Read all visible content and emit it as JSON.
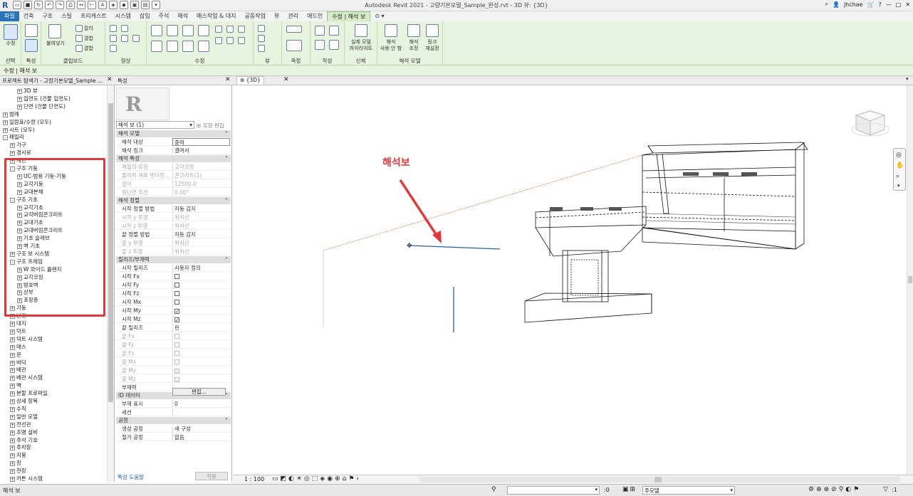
{
  "titlebar": {
    "title": "Autodesk Revit 2021 - 고량기본모델_Sample_완성.rvt - 3D 뷰: {3D}",
    "user": "jhchae"
  },
  "tabs": [
    "파일",
    "건축",
    "구조",
    "스틸",
    "프리캐스트",
    "시스템",
    "삽입",
    "주석",
    "해석",
    "매스작업 & 대지",
    "공동작업",
    "뷰",
    "관리",
    "애드인",
    "수정 | 해석 보"
  ],
  "ribbon": {
    "groups": [
      "선택",
      "특성",
      "클립보드",
      "형상",
      "수정",
      "뷰",
      "측정",
      "작성",
      "신체",
      "해석 모델"
    ],
    "modify_label": "수정",
    "paste_label": "붙여넣기",
    "highlight_label": "실제 모델\n하이라이트",
    "beam_tool_label": "해석\n사용 안 함",
    "adjust_label": "해석\n조정",
    "link_label": "링크\n재설정",
    "clipboard_labels": [
      "잘라",
      "결합",
      "결합"
    ]
  },
  "optionsbar": {
    "text": "수정 | 해석 보"
  },
  "panels": {
    "browser_title": "프로젝트 탐색기 - 고량기본모델_Sample ...",
    "properties_title": "특성",
    "view_tab": "{3D}"
  },
  "browser": {
    "items": [
      {
        "label": "3D 뷰",
        "level": 2,
        "exp": "+"
      },
      {
        "label": "입면도 (건물 입면도)",
        "level": 2,
        "exp": "+"
      },
      {
        "label": "단면 (건물 단면도)",
        "level": 2,
        "exp": "+"
      },
      {
        "label": "범례",
        "level": 0,
        "exp": "+"
      },
      {
        "label": "일람표/수량 (모두)",
        "level": 0,
        "exp": "+"
      },
      {
        "label": "시트 (모두)",
        "level": 0,
        "exp": "+"
      },
      {
        "label": "패밀리",
        "level": 0,
        "exp": "-"
      },
      {
        "label": "가구",
        "level": 1,
        "exp": "+"
      },
      {
        "label": "경사로",
        "level": 1,
        "exp": "+"
      },
      {
        "label": "계단",
        "level": 1,
        "exp": "+"
      },
      {
        "label": "구조 기둥",
        "level": 1,
        "exp": "-"
      },
      {
        "label": "UC-범용 기둥-기둥",
        "level": 2,
        "exp": "+"
      },
      {
        "label": "교각기둥",
        "level": 2,
        "exp": "+"
      },
      {
        "label": "교대본체",
        "level": 2,
        "exp": "+"
      },
      {
        "label": "구조 기초",
        "level": 1,
        "exp": "-"
      },
      {
        "label": "교각기초",
        "level": 2,
        "exp": "+"
      },
      {
        "label": "교각버림콘크리트",
        "level": 2,
        "exp": "+"
      },
      {
        "label": "교대기초",
        "level": 2,
        "exp": "+"
      },
      {
        "label": "교대버림콘크리트",
        "level": 2,
        "exp": "+"
      },
      {
        "label": "기초 슬래브",
        "level": 2,
        "exp": "+"
      },
      {
        "label": "벽 기초",
        "level": 2,
        "exp": "+"
      },
      {
        "label": "구조 보 시스템",
        "level": 1,
        "exp": "+"
      },
      {
        "label": "구조 프레임",
        "level": 1,
        "exp": "-"
      },
      {
        "label": "W 와이드 플랜지",
        "level": 2,
        "exp": "+"
      },
      {
        "label": "교각코핑",
        "level": 2,
        "exp": "+"
      },
      {
        "label": "방호벽",
        "level": 2,
        "exp": "+"
      },
      {
        "label": "상부",
        "level": 2,
        "exp": "+"
      },
      {
        "label": "포장층",
        "level": 2,
        "exp": "+"
      },
      {
        "label": "기둥",
        "level": 1,
        "exp": "+"
      },
      {
        "label": "난간",
        "level": 1,
        "exp": "+"
      },
      {
        "label": "대지",
        "level": 1,
        "exp": "+"
      },
      {
        "label": "덕트",
        "level": 1,
        "exp": "+"
      },
      {
        "label": "덕트 시스템",
        "level": 1,
        "exp": "+"
      },
      {
        "label": "매스",
        "level": 1,
        "exp": "+"
      },
      {
        "label": "문",
        "level": 1,
        "exp": "+"
      },
      {
        "label": "바닥",
        "level": 1,
        "exp": "+"
      },
      {
        "label": "배관",
        "level": 1,
        "exp": "+"
      },
      {
        "label": "배관 시스템",
        "level": 1,
        "exp": "+"
      },
      {
        "label": "벽",
        "level": 1,
        "exp": "+"
      },
      {
        "label": "분할 프로파일",
        "level": 1,
        "exp": "+"
      },
      {
        "label": "상세 항목",
        "level": 1,
        "exp": "+"
      },
      {
        "label": "수직",
        "level": 1,
        "exp": "+"
      },
      {
        "label": "일반 모델",
        "level": 1,
        "exp": "+"
      },
      {
        "label": "전선관",
        "level": 1,
        "exp": "+"
      },
      {
        "label": "조명 설비",
        "level": 1,
        "exp": "+"
      },
      {
        "label": "주석 기호",
        "level": 1,
        "exp": "+"
      },
      {
        "label": "주차장",
        "level": 1,
        "exp": "+"
      },
      {
        "label": "지붕",
        "level": 1,
        "exp": "+"
      },
      {
        "label": "창",
        "level": 1,
        "exp": "+"
      },
      {
        "label": "천장",
        "level": 1,
        "exp": "+"
      },
      {
        "label": "커튼 시스템",
        "level": 1,
        "exp": "+"
      }
    ]
  },
  "properties": {
    "type_selector": "해석 보 (1)",
    "edit_type": "유형 편집",
    "sections": [
      {
        "title": "해석 모델",
        "rows": [
          {
            "k": "해석 대상",
            "v": "중력",
            "editable": true
          },
          {
            "k": "해석 링크",
            "v": "결여서"
          }
        ]
      },
      {
        "title": "해석 특성",
        "rows": [
          {
            "k": "재질의 유형",
            "v": "교각코핑",
            "dim": true
          },
          {
            "k": "물리적 재료 렌더링...",
            "v": "콘크리트(1)",
            "dim": true
          },
          {
            "k": "길이",
            "v": "12500.0",
            "dim": true
          },
          {
            "k": "횡단면 회전",
            "v": "0.00°",
            "dim": true
          }
        ]
      },
      {
        "title": "해석 정렬",
        "rows": [
          {
            "k": "시작 정렬 방법",
            "v": "자동 감지"
          },
          {
            "k": "시작 y 투영",
            "v": "위치선",
            "dim": true
          },
          {
            "k": "시작 z 투영",
            "v": "위치선",
            "dim": true
          },
          {
            "k": "끝 정렬 방법",
            "v": "자동 감지"
          },
          {
            "k": "끝 y 투영",
            "v": "위치선",
            "dim": true
          },
          {
            "k": "끝 z 투영",
            "v": "위치선",
            "dim": true
          }
        ]
      },
      {
        "title": "릴리즈/부재력",
        "rows": [
          {
            "k": "시작 릴리즈",
            "v": "사용자 정의"
          },
          {
            "k": "시작 Fx",
            "cb": false
          },
          {
            "k": "시작 Fy",
            "cb": false
          },
          {
            "k": "시작 Fz",
            "cb": false
          },
          {
            "k": "시작 Mx",
            "cb": false
          },
          {
            "k": "시작 My",
            "cb": true
          },
          {
            "k": "시작 Mz",
            "cb": true
          },
          {
            "k": "끝 릴리즈",
            "v": "핀"
          },
          {
            "k": "끝 Fx",
            "cb": false,
            "dim": true
          },
          {
            "k": "끝 Fy",
            "cb": false,
            "dim": true
          },
          {
            "k": "끝 Fz",
            "cb": false,
            "dim": true
          },
          {
            "k": "끝 Mx",
            "cb": false,
            "dim": true
          },
          {
            "k": "끝 My",
            "cb": true,
            "dim": true
          },
          {
            "k": "끝 Mz",
            "cb": true,
            "dim": true
          },
          {
            "k": "부재력",
            "v": ""
          }
        ]
      },
      {
        "title": "ID 데이터",
        "rows": [
          {
            "k": "부재 표시",
            "v": "0"
          },
          {
            "k": "세션",
            "v": ""
          }
        ]
      },
      {
        "title": "공정",
        "rows": [
          {
            "k": "생성 공정",
            "v": "새 구성"
          },
          {
            "k": "철거 공정",
            "v": "없음"
          }
        ]
      }
    ],
    "edit_button": "편집...",
    "help_link": "특성 도움말",
    "apply_button": "적용"
  },
  "view": {
    "annotation": "해석보",
    "scale": "1 : 100",
    "colors": {
      "annotation": "#e0393d",
      "beam": "#2b5ca8",
      "grid": "#e07a3a"
    }
  },
  "statusbar": {
    "left": "해석 보",
    "coord": ":0",
    "model": "주모델"
  }
}
